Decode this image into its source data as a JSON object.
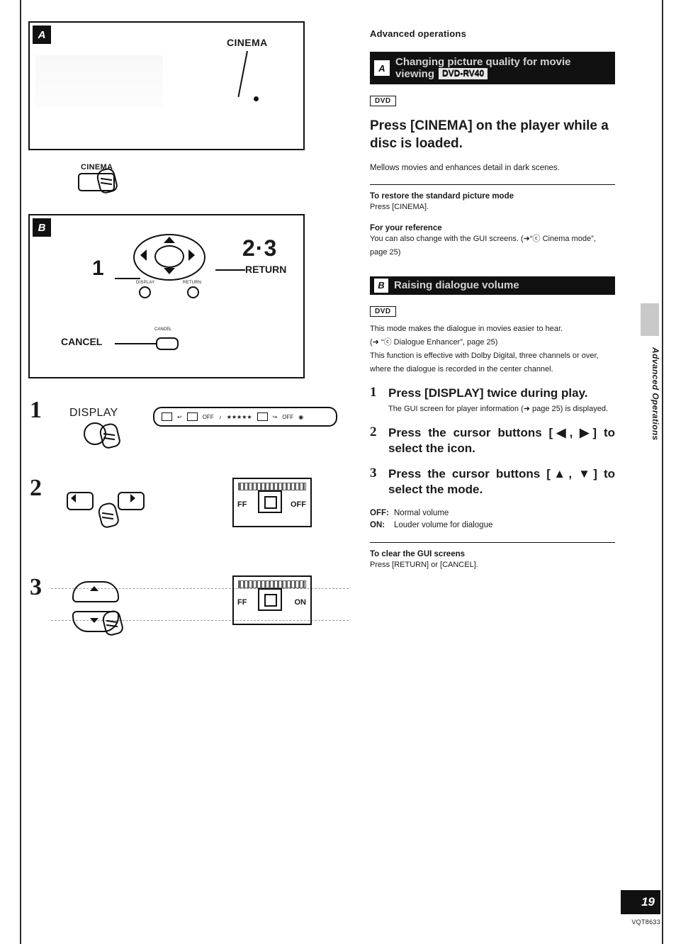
{
  "document": {
    "section_title": "Advanced operations",
    "side_tab_text": "Advanced Operations",
    "page_number": "19",
    "doc_code": "VQT8633"
  },
  "section_a": {
    "badge": "A",
    "bar_title": "Changing picture quality for movie viewing",
    "model_chip": "DVD-RV40",
    "media_chip": "DVD",
    "heading": "Press [CINEMA] on the player while a disc is loaded.",
    "description": "Mellows movies and enhances detail in dark scenes.",
    "restore_head": "To restore the standard picture mode",
    "restore_body": "Press [CINEMA].",
    "reference_head": "For your reference",
    "reference_body_1": "You can also change with the GUI screens. (➜“ⓒ Cinema mode”,",
    "reference_body_2": "page 25)"
  },
  "section_b": {
    "badge": "B",
    "bar_title": "Raising dialogue volume",
    "media_chip": "DVD",
    "intro_1": "This mode makes the dialogue in movies easier to hear.",
    "intro_2": "(➜ “ⓒ Dialogue Enhancer”, page 25)",
    "intro_3": "This function is effective with Dolby Digital, three channels or over,",
    "intro_4": "where the dialogue is recorded in the center channel.",
    "steps": [
      {
        "number": "1",
        "title": "Press [DISPLAY] twice during play.",
        "sub": "The GUI screen for player information (➜ page 25) is displayed."
      },
      {
        "number": "2",
        "title": "Press the cursor buttons [◀, ▶] to select the icon.",
        "sub": ""
      },
      {
        "number": "3",
        "title": "Press the cursor buttons [▲, ▼] to select the mode.",
        "sub": ""
      }
    ],
    "modes": [
      {
        "key": "OFF:",
        "value": "Normal volume"
      },
      {
        "key": "ON:",
        "value": "Louder volume for dialogue"
      }
    ],
    "clear_head": "To clear the GUI screens",
    "clear_body": "Press [RETURN] or [CANCEL]."
  },
  "figures": {
    "panel_a": {
      "badge": "A",
      "callout": "CINEMA",
      "button_label": "CINEMA"
    },
    "panel_b": {
      "badge": "B",
      "label_23": "2·3",
      "label_return": "RETURN",
      "label_1": "1",
      "label_cancel": "CANCEL",
      "mini_cancel": "CANCEL",
      "mini_display": "DISPLAY",
      "mini_return": "RETURN"
    },
    "step1": {
      "number": "1",
      "label": "DISPLAY",
      "osd_items": [
        "▤",
        "↩",
        "▦",
        "OFF",
        "♪",
        "✳✳✳✳✳",
        "▭",
        "↪",
        "OFF",
        "◍"
      ]
    },
    "step2": {
      "number": "2",
      "tv_left": "FF",
      "tv_state": "OFF"
    },
    "step3": {
      "number": "3",
      "tv_left": "FF",
      "tv_state": "ON"
    }
  }
}
